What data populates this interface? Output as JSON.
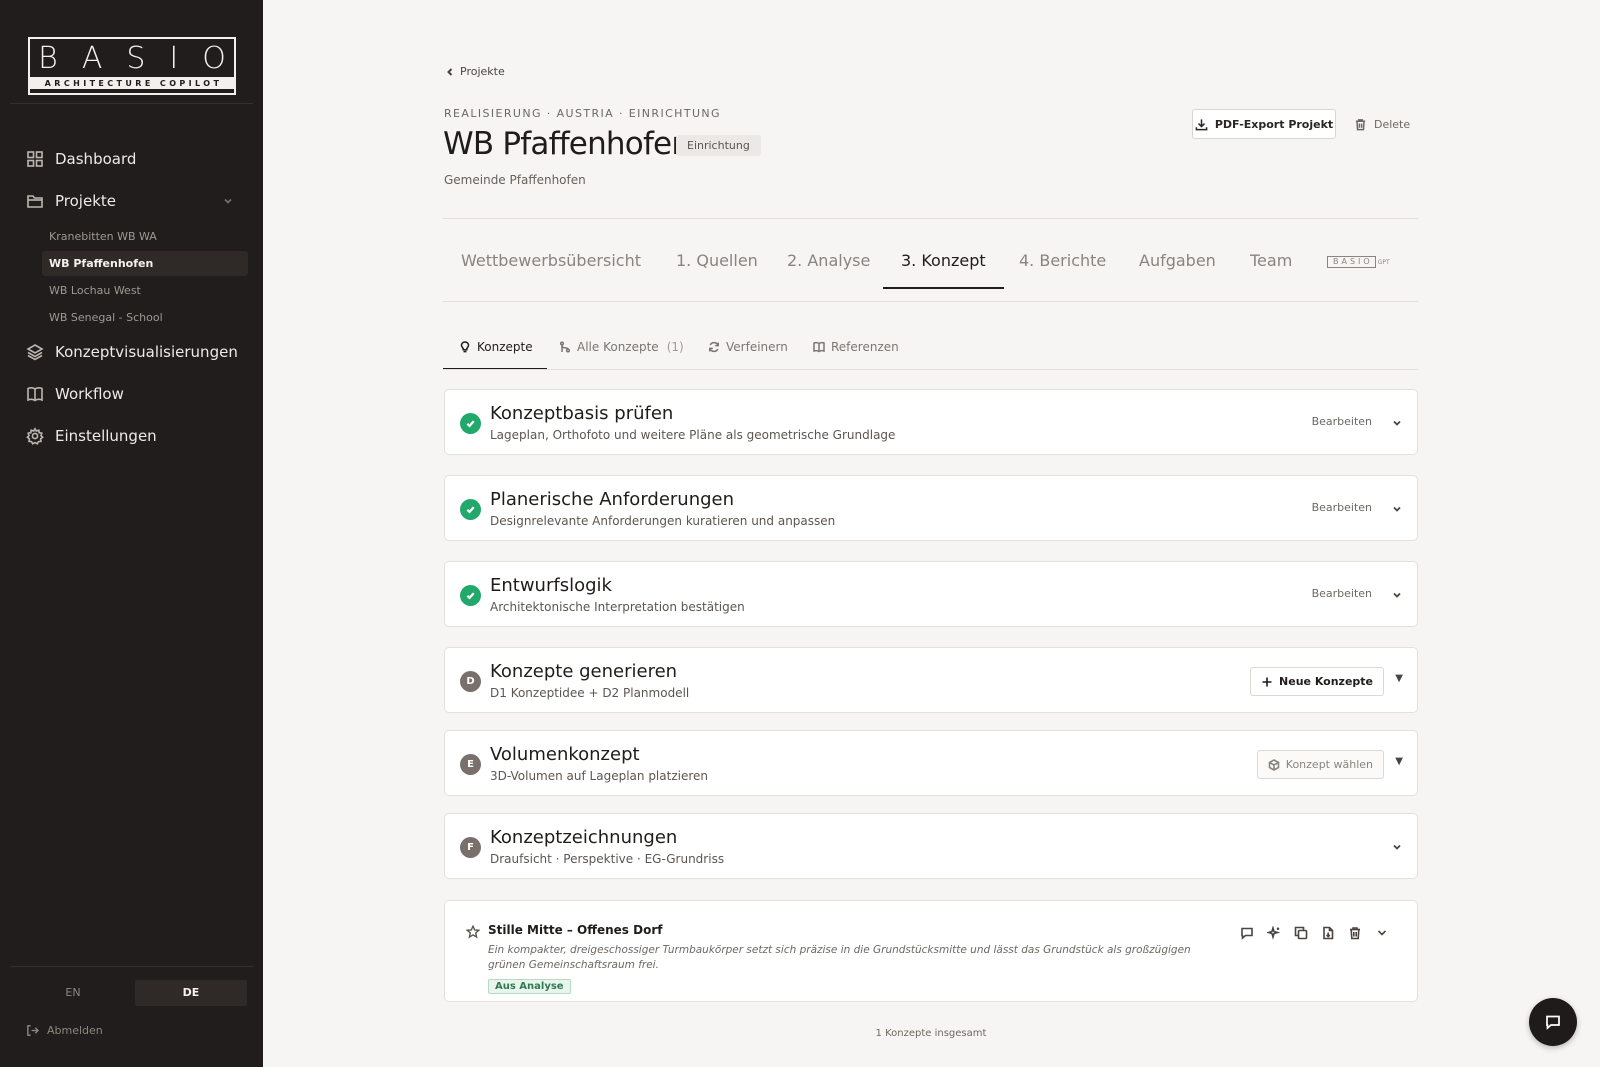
{
  "brand": {
    "logo_main": "BASIO",
    "logo_sub": "ARCHITECTURE COPILOT"
  },
  "sidebar": {
    "nav": [
      {
        "label": "Dashboard",
        "icon": "grid-icon"
      },
      {
        "label": "Projekte",
        "icon": "folder-icon"
      },
      {
        "label": "Konzeptvisualisierungen",
        "icon": "layers-icon"
      },
      {
        "label": "Workflow",
        "icon": "book-icon"
      },
      {
        "label": "Einstellungen",
        "icon": "gear-icon"
      }
    ],
    "projects": [
      {
        "label": "Kranebitten WB WA"
      },
      {
        "label": "WB Pfaffenhofen",
        "active": true
      },
      {
        "label": "WB Lochau West"
      },
      {
        "label": "WB Senegal - School"
      }
    ],
    "lang": {
      "en": "EN",
      "de": "DE",
      "selected": "DE"
    },
    "logout": "Abmelden"
  },
  "header": {
    "back": "Projekte",
    "crumbs": "REALISIERUNG · AUSTRIA · EINRICHTUNG",
    "title": "WB Pfaffenhofen",
    "status": "Einrichtung",
    "subtitle": "Gemeinde Pfaffenhofen",
    "pdf_button": "PDF-Export Projekt",
    "delete_button": "Delete"
  },
  "tabs": [
    {
      "label": "Wettbewerbsübersicht"
    },
    {
      "label": "1. Quellen"
    },
    {
      "label": "2. Analyse"
    },
    {
      "label": "3. Konzept",
      "active": true
    },
    {
      "label": "4. Berichte"
    },
    {
      "label": "Aufgaben"
    },
    {
      "label": "Team"
    }
  ],
  "gpt_tab": {
    "logo": "BASIO",
    "suffix": "GPT"
  },
  "subtabs": [
    {
      "label": "Konzepte",
      "icon": "lightbulb-icon",
      "active": true
    },
    {
      "label": "Alle Konzepte",
      "icon": "merge-icon",
      "count": "(1)"
    },
    {
      "label": "Verfeinern",
      "icon": "refresh-icon"
    },
    {
      "label": "Referenzen",
      "icon": "book-open-icon"
    }
  ],
  "steps": [
    {
      "title": "Konzeptbasis prüfen",
      "desc": "Lageplan, Orthofoto und weitere Pläne als geometrische Grundlage",
      "status": "done",
      "action": "Bearbeiten"
    },
    {
      "title": "Planerische Anforderungen",
      "desc": "Designrelevante Anforderungen kuratieren und anpassen",
      "status": "done",
      "action": "Bearbeiten"
    },
    {
      "title": "Entwurfslogik",
      "desc": "Architektonische Interpretation bestätigen",
      "status": "done",
      "action": "Bearbeiten"
    },
    {
      "title": "Konzepte generieren",
      "desc": "D1 Konzeptidee + D2 Planmodell",
      "status": "D",
      "action": "Neue Konzepte"
    },
    {
      "title": "Volumenkonzept",
      "desc": "3D-Volumen auf Lageplan platzieren",
      "status": "E",
      "action": "Konzept wählen"
    },
    {
      "title": "Konzeptzeichnungen",
      "desc": "Draufsicht · Perspektive · EG-Grundriss",
      "status": "F",
      "action": ""
    }
  ],
  "concept": {
    "title": "Stille Mitte – Offenes Dorf",
    "desc": "Ein kompakter, dreigeschossiger Turmbaukörper setzt sich präzise in die Grundstücksmitte und lässt das Grundstück als großzügigen grünen Gemeinschaftsraum frei.",
    "tag": "Aus Analyse"
  },
  "total": "1 Konzepte insgesamt",
  "colors": {
    "sidebar_bg": "#211d1c",
    "done_green": "#22a86b",
    "page_bg": "#f6f5f3"
  }
}
